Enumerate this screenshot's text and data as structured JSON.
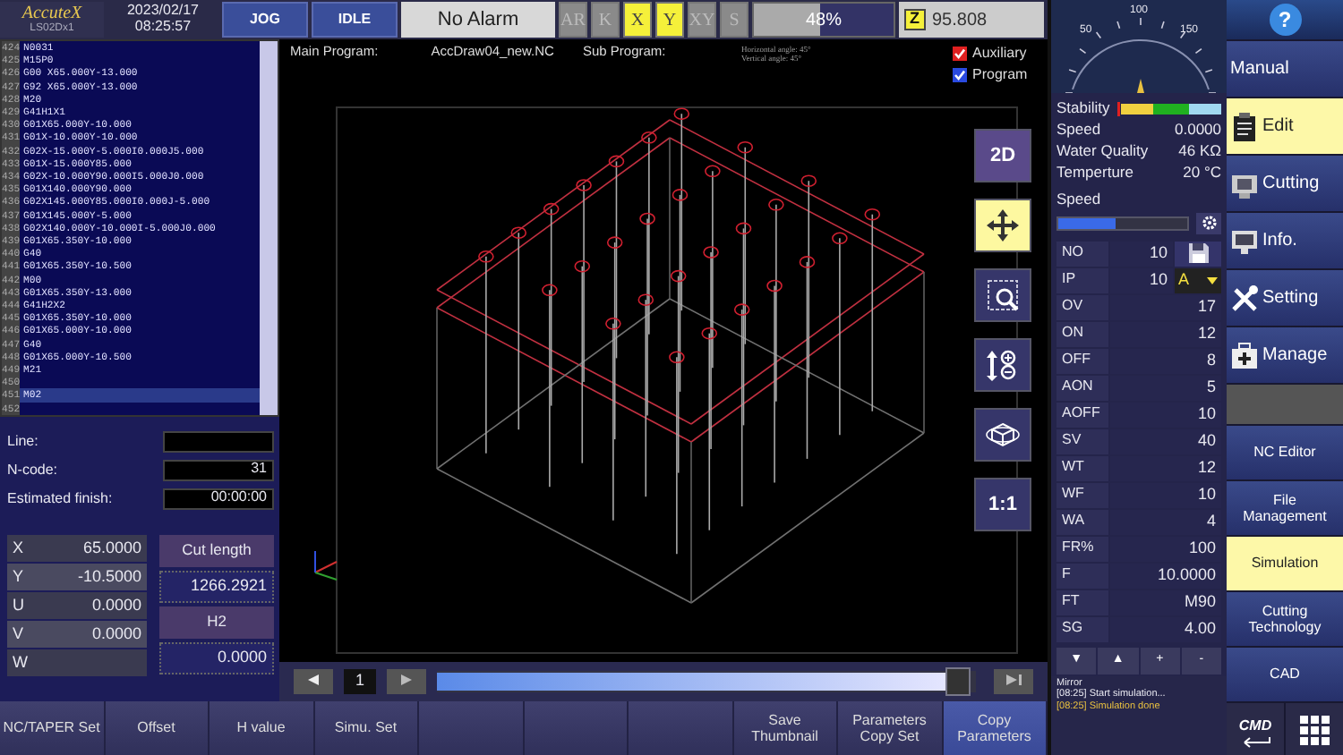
{
  "header": {
    "logo": "AccuteX",
    "model": "LS02Dx1",
    "date": "2023/02/17",
    "time": "08:25:57"
  },
  "mode_buttons": [
    {
      "label": "JOG"
    },
    {
      "label": "IDLE"
    }
  ],
  "alarm": "No Alarm",
  "axis_toggles": [
    {
      "label": "AR",
      "on": false
    },
    {
      "label": "K",
      "on": false
    },
    {
      "label": "X",
      "on": true
    },
    {
      "label": "Y",
      "on": true
    },
    {
      "label": "XY",
      "on": false
    },
    {
      "label": "S",
      "on": false
    }
  ],
  "progress": {
    "level": 0.48,
    "text": "48%"
  },
  "z_readout": {
    "label": "Z",
    "value": "95.808"
  },
  "code": {
    "lines": [
      {
        "number": "424",
        "text": "N0031",
        "selected": false
      },
      {
        "number": "425",
        "text": "M15P0",
        "selected": false
      },
      {
        "number": "426",
        "text": "G00 X65.000Y-13.000",
        "selected": false
      },
      {
        "number": "427",
        "text": "G92 X65.000Y-13.000",
        "selected": false
      },
      {
        "number": "428",
        "text": "M20",
        "selected": false
      },
      {
        "number": "429",
        "text": "G41H1X1",
        "selected": false
      },
      {
        "number": "430",
        "text": "G01X65.000Y-10.000",
        "selected": false
      },
      {
        "number": "431",
        "text": "G01X-10.000Y-10.000",
        "selected": false
      },
      {
        "number": "432",
        "text": "G02X-15.000Y-5.000I0.000J5.000",
        "selected": false
      },
      {
        "number": "433",
        "text": "G01X-15.000Y85.000",
        "selected": false
      },
      {
        "number": "434",
        "text": "G02X-10.000Y90.000I5.000J0.000",
        "selected": false
      },
      {
        "number": "435",
        "text": "G01X140.000Y90.000",
        "selected": false
      },
      {
        "number": "436",
        "text": "G02X145.000Y85.000I0.000J-5.000",
        "selected": false
      },
      {
        "number": "437",
        "text": "G01X145.000Y-5.000",
        "selected": false
      },
      {
        "number": "438",
        "text": "G02X140.000Y-10.000I-5.000J0.000",
        "selected": false
      },
      {
        "number": "439",
        "text": "G01X65.350Y-10.000",
        "selected": false
      },
      {
        "number": "440",
        "text": "G40",
        "selected": false
      },
      {
        "number": "441",
        "text": "G01X65.350Y-10.500",
        "selected": false
      },
      {
        "number": "442",
        "text": "M00",
        "selected": false
      },
      {
        "number": "443",
        "text": "G01X65.350Y-13.000",
        "selected": false
      },
      {
        "number": "444",
        "text": "G41H2X2",
        "selected": false
      },
      {
        "number": "445",
        "text": "G01X65.350Y-10.000",
        "selected": false
      },
      {
        "number": "446",
        "text": "G01X65.000Y-10.000",
        "selected": false
      },
      {
        "number": "447",
        "text": "G40",
        "selected": false
      },
      {
        "number": "448",
        "text": "G01X65.000Y-10.500",
        "selected": false
      },
      {
        "number": "449",
        "text": "M21",
        "selected": false
      },
      {
        "number": "450",
        "selected": false
      },
      {
        "number": "451",
        "text": "M02",
        "selected": true
      },
      {
        "number": "452",
        "selected": false
      }
    ]
  },
  "info": {
    "fields": [
      {
        "label": "Line:"
      },
      {
        "label": "N-code:",
        "value": "31"
      },
      {
        "label": "Estimated finish:",
        "value": "00:00:00"
      }
    ]
  },
  "coordinates": [
    {
      "axis": "X",
      "value": "65.0000"
    },
    {
      "axis": "Y",
      "value": "-10.5000"
    },
    {
      "axis": "U",
      "value": "0.0000"
    },
    {
      "axis": "V",
      "value": "0.0000"
    },
    {
      "axis": "W"
    }
  ],
  "cut_length": {
    "label": "Cut length",
    "value": "1266.2921"
  },
  "h_value": {
    "label": "H2",
    "value": "0.0000"
  },
  "viewer": {
    "main_program_label": "Main Program:",
    "main_program": "AccDraw04_new.NC",
    "sub_program_label": "Sub Program:",
    "angles": [
      "Horizontal angle: 45°",
      "Vertical angle: 45°"
    ],
    "options": [
      {
        "label": "Auxiliary",
        "checked": true,
        "color": "#e02020"
      },
      {
        "label": "Program",
        "checked": true,
        "color": "#2a4ae0"
      }
    ],
    "tools": [
      {
        "kind": "plane",
        "label": "2D",
        "selected": false
      },
      {
        "kind": "pan",
        "selected": true
      },
      {
        "kind": "magnify",
        "selected": false
      },
      {
        "kind": "scale",
        "selected": false
      },
      {
        "kind": "rotate",
        "selected": false
      },
      {
        "kind": "fit",
        "label": "1:1",
        "selected": false
      }
    ]
  },
  "playback": {
    "page": "1",
    "level": 0.97
  },
  "function_keys": [
    {
      "label": "NC/TAPER Set",
      "selected": false
    },
    {
      "label": "Offset",
      "selected": false
    },
    {
      "label": "H value",
      "selected": false
    },
    {
      "label": "Simu. Set",
      "selected": false
    },
    {
      "selected": false
    },
    {
      "selected": false
    },
    {
      "selected": false
    },
    {
      "label": "Save Thumbnail",
      "selected": false
    },
    {
      "label": "Parameters Copy Set",
      "selected": false
    },
    {
      "label": "Copy Parameters",
      "selected": true
    }
  ],
  "gauge": {
    "ticks": [
      "50",
      "100",
      "150"
    ]
  },
  "machine": {
    "stability_label": "Stability",
    "readings": [
      {
        "label": "Speed",
        "value": "0.0000"
      },
      {
        "label": "Water Quality",
        "value": "46 KΩ"
      },
      {
        "label": "Temperture",
        "value": "20 °C"
      }
    ]
  },
  "speed": {
    "label": "Speed",
    "level": 0.45
  },
  "parameters": [
    {
      "name": "NO",
      "value": "10",
      "kind": "save"
    },
    {
      "name": "IP",
      "value": "10",
      "kind": "select",
      "option": "A"
    },
    {
      "name": "OV",
      "value": "17"
    },
    {
      "name": "ON",
      "value": "12"
    },
    {
      "name": "OFF",
      "value": "8"
    },
    {
      "name": "AON",
      "value": "5"
    },
    {
      "name": "AOFF",
      "value": "10"
    },
    {
      "name": "SV",
      "value": "40"
    },
    {
      "name": "WT",
      "value": "12"
    },
    {
      "name": "WF",
      "value": "10"
    },
    {
      "name": "WA",
      "value": "4"
    },
    {
      "name": "FR%",
      "value": "100"
    },
    {
      "name": "F",
      "value": "10.0000"
    },
    {
      "name": "FT",
      "value": "M90"
    },
    {
      "name": "SG",
      "value": "4.00"
    }
  ],
  "param_buttons": [
    "▼",
    "▲",
    "+",
    "-"
  ],
  "messages": [
    {
      "text": "Mirror",
      "color": "#e8e8f0"
    },
    {
      "text": "[08:25] Start simulation...",
      "color": "#e8e8f0"
    },
    {
      "text": "[08:25] Simulation done",
      "color": "#e8c040"
    }
  ],
  "nav": [
    {
      "kind": "help",
      "label": "?"
    },
    {
      "kind": "manual",
      "label": "Manual",
      "selected": false
    },
    {
      "kind": "edit",
      "label": "Edit",
      "selected": true
    },
    {
      "kind": "cutting",
      "label": "Cutting",
      "selected": false
    },
    {
      "kind": "info",
      "label": "Info.",
      "selected": false
    },
    {
      "kind": "setting",
      "label": "Setting",
      "selected": false
    },
    {
      "kind": "manage",
      "label": "Manage",
      "selected": false
    },
    {
      "kind": "blank"
    },
    {
      "kind": "sub",
      "label": "NC Editor",
      "selected": false
    },
    {
      "kind": "sub",
      "label": "File Management",
      "selected": false
    },
    {
      "kind": "sub",
      "label": "Simulation",
      "selected": true
    },
    {
      "kind": "sub",
      "label": "Cutting Technology",
      "selected": false
    },
    {
      "kind": "sub",
      "label": "CAD",
      "selected": false
    },
    {
      "kind": "tools",
      "label": "CMD"
    }
  ]
}
